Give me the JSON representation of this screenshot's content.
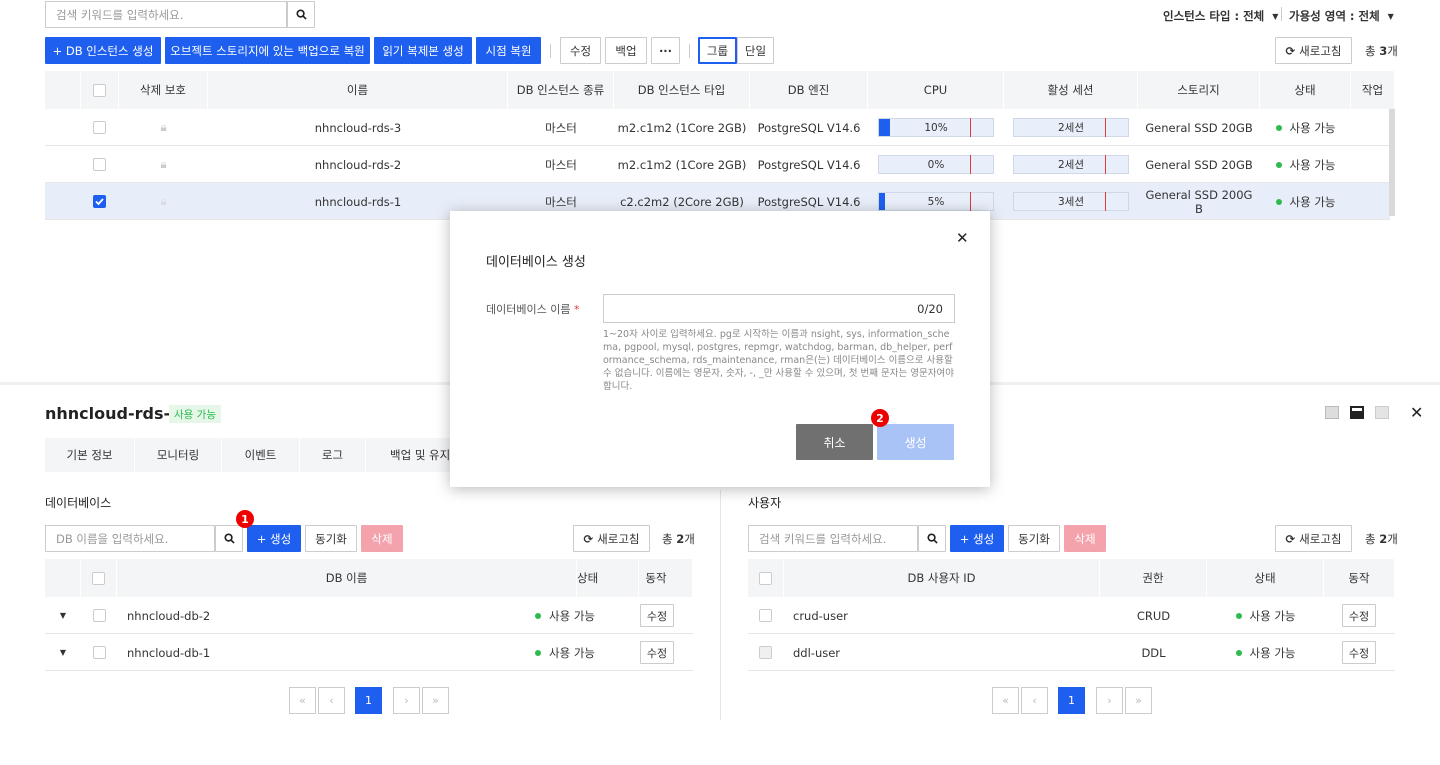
{
  "top": {
    "search_placeholder": "검색 키워드를 입력하세요.",
    "instance_type_filter": "인스턴스 타입 : 전체",
    "availability_filter": "가용성 영역 : 전체",
    "buttons": {
      "create_db_instance": "+ DB 인스턴스 생성",
      "restore_object_storage": "오브젝트 스토리지에 있는 백업으로 복원",
      "create_read_replica": "읽기 복제본 생성",
      "pitr": "시점 복원",
      "modify": "수정",
      "backup": "백업",
      "more": "···",
      "group": "그룹",
      "single": "단일",
      "refresh": "새로고침"
    },
    "total_prefix": "총 ",
    "total_count": "3",
    "total_suffix": "개"
  },
  "instances_table": {
    "headers": [
      "삭제 보호",
      "이름",
      "DB 인스턴스 종류",
      "DB 인스턴스 타입",
      "DB 엔진",
      "CPU",
      "활성 세션",
      "스토리지",
      "상태",
      "작업"
    ],
    "rows": [
      {
        "name": "nhncloud-rds-3",
        "kind": "마스터",
        "type": "m2.c1m2 (1Core 2GB)",
        "engine": "PostgreSQL V14.6",
        "cpu_text": "10%",
        "cpu_value": 0.1,
        "session": "2세션",
        "storage": "General SSD 20GB",
        "status": "사용 가능",
        "checked": false
      },
      {
        "name": "nhncloud-rds-2",
        "kind": "마스터",
        "type": "m2.c1m2 (1Core 2GB)",
        "engine": "PostgreSQL V14.6",
        "cpu_text": "0%",
        "cpu_value": 0.0,
        "session": "2세션",
        "storage": "General SSD 20GB",
        "status": "사용 가능",
        "checked": false
      },
      {
        "name": "nhncloud-rds-1",
        "kind": "마스터",
        "type": "c2.c2m2 (2Core 2GB)",
        "engine": "PostgreSQL V14.6",
        "cpu_text": "5%",
        "cpu_value": 0.05,
        "session": "3세션",
        "storage": "General SSD 200G B",
        "status": "사용 가능",
        "checked": true
      }
    ]
  },
  "detail": {
    "title": "nhncloud-rds-1",
    "status_badge": "사용 가능",
    "tabs": [
      "기본 정보",
      "모니터링",
      "이벤트",
      "로그",
      "백업 및 유지 ..."
    ]
  },
  "databases": {
    "section_title": "데이터베이스",
    "search_placeholder": "DB 이름을 입력하세요.",
    "create": "+ 생성",
    "sync": "동기화",
    "delete": "삭제",
    "refresh": "새로고침",
    "total_prefix": "총 ",
    "total_count": "2",
    "total_suffix": "개",
    "headers": [
      "DB 이름",
      "상태",
      "동작"
    ],
    "rows": [
      {
        "name": "nhncloud-db-2",
        "status": "사용 가능",
        "action": "수정"
      },
      {
        "name": "nhncloud-db-1",
        "status": "사용 가능",
        "action": "수정"
      }
    ],
    "pagination": {
      "first": "«",
      "prev": "‹",
      "page": "1",
      "next": "›",
      "last": "»"
    }
  },
  "users": {
    "section_title": "사용자",
    "search_placeholder": "검색 키워드를 입력하세요.",
    "create": "+ 생성",
    "sync": "동기화",
    "delete": "삭제",
    "refresh": "새로고침",
    "total_prefix": "총 ",
    "total_count": "2",
    "total_suffix": "개",
    "headers": [
      "DB 사용자 ID",
      "권한",
      "상태",
      "동작"
    ],
    "rows": [
      {
        "id": "crud-user",
        "permission": "CRUD",
        "status": "사용 가능",
        "action": "수정"
      },
      {
        "id": "ddl-user",
        "permission": "DDL",
        "status": "사용 가능",
        "action": "수정"
      }
    ],
    "pagination": {
      "first": "«",
      "prev": "‹",
      "page": "1",
      "next": "›",
      "last": "»"
    }
  },
  "modal": {
    "title": "데이터베이스 생성",
    "field_label": "데이터베이스 이름",
    "required_mark": "*",
    "counter": "0/20",
    "help": "1~20자 사이로 입력하세요. pg로 시작하는 이름과 nsight, sys, information_schema, pgpool, mysql, postgres, repmgr, watchdog, barman, db_helper, performance_schema, rds_maintenance, rman은(는) 데이터베이스 이름으로 사용할 수 없습니다. 이름에는 영문자, 숫자, -, _만 사용할 수 있으며, 첫 번째 문자는 영문자여야 합니다.",
    "cancel": "취소",
    "create": "생성",
    "close": "✕"
  },
  "markers": {
    "one": "1",
    "two": "2"
  },
  "colors": {
    "primary": "#1f5ff0",
    "danger": "#f4a3ad",
    "status_ok": "#2dbb4f",
    "marker": "#e00000"
  }
}
